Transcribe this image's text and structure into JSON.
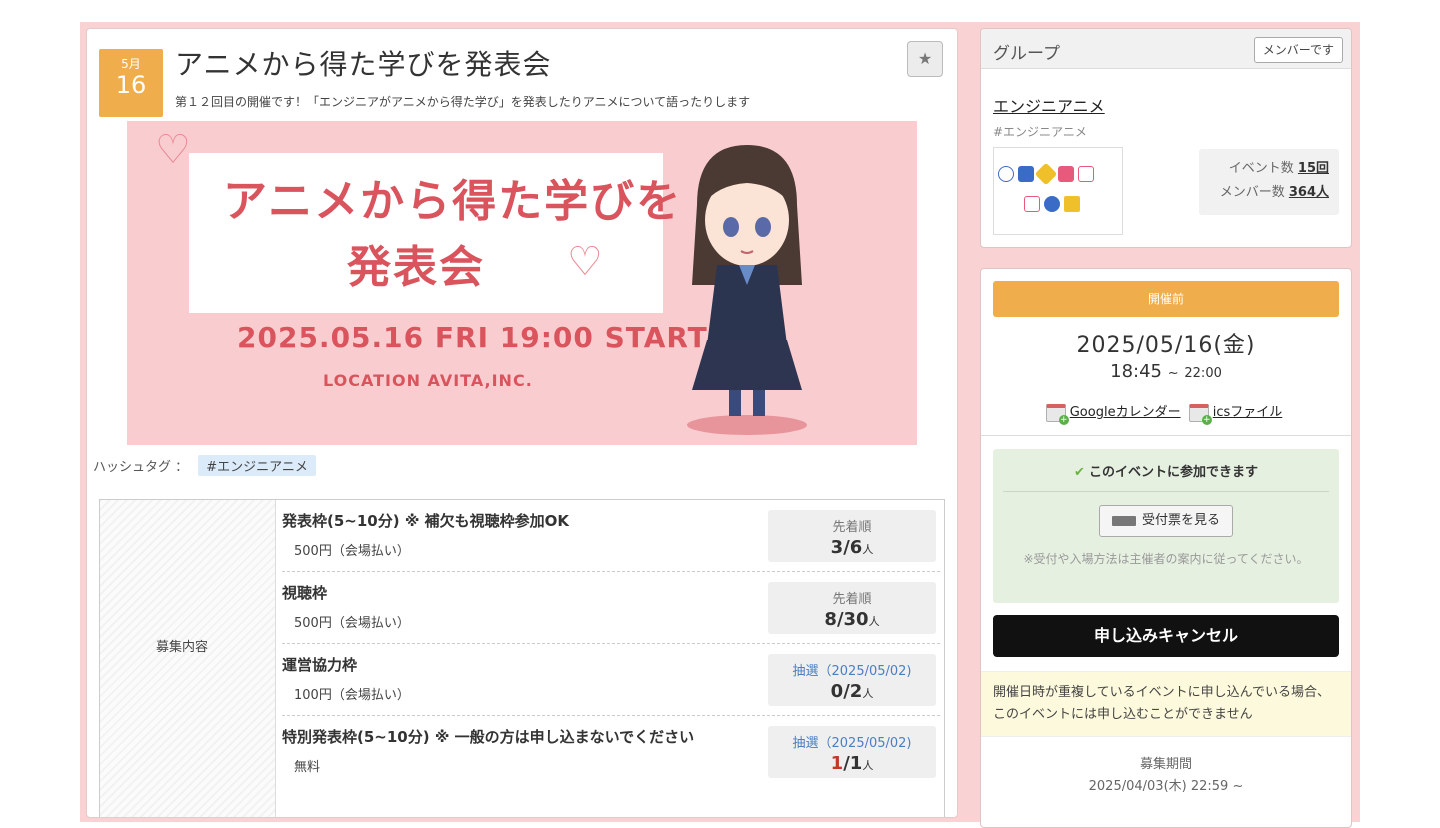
{
  "event": {
    "month": "5月",
    "day": "16",
    "title": "アニメから得た学びを発表会",
    "subtitle": "第１２回目の開催です！「エンジニアがアニメから得た学び」を発表したりアニメについて語ったりします",
    "star_icon": "★"
  },
  "banner": {
    "title_line1": "アニメから得た学びを",
    "title_line2": "発表会",
    "date_line": "2025.05.16 FRI 19:00 START",
    "location_line": "LOCATION AVITA,INC."
  },
  "hashtag": {
    "label": "ハッシュタグ ：",
    "value": "#エンジニアニメ"
  },
  "recruit": {
    "label": "募集内容",
    "slots": [
      {
        "name": "発表枠(5~10分) ※ 補欠も視聴枠参加OK",
        "price": "500円（会場払い）",
        "method": "先着順",
        "current": "3",
        "capacity": "/6",
        "unit": "人"
      },
      {
        "name": "視聴枠",
        "price": "500円（会場払い）",
        "method": "先着順",
        "current": "8",
        "capacity": "/30",
        "unit": "人"
      },
      {
        "name": "運営協力枠",
        "price": "100円（会場払い）",
        "method": "抽選（2025/05/02)",
        "current": "0",
        "capacity": "/2",
        "unit": "人"
      },
      {
        "name": "特別発表枠(5~10分) ※ 一般の方は申し込まないでください",
        "price": "無料",
        "method": "抽選（2025/05/02)",
        "current": "1",
        "capacity": "/1",
        "unit": "人"
      }
    ]
  },
  "group": {
    "heading": "グループ",
    "member_button": "メンバーです",
    "name": "エンジニアニメ",
    "tag": "#エンジニアニメ",
    "event_count_label": "イベント数",
    "event_count": "15回",
    "member_count_label": "メンバー数",
    "member_count": "364人"
  },
  "status": {
    "badge": "開催前",
    "date": "2025/05/16(金)",
    "start_time": "18:45",
    "tilde": "~",
    "end_time": "22:00",
    "google_link": "Googleカレンダー",
    "ics_link": "icsファイル",
    "join_ok": "このイベントに参加できます",
    "ticket_button": "受付票を見る",
    "join_note": "※受付や入場方法は主催者の案内に従ってください。",
    "cancel_button": "申し込みキャンセル",
    "warning": "開催日時が重複しているイベントに申し込んでいる場合、このイベントには申し込むことができません",
    "period_label": "募集期間",
    "period_value": "2025/04/03(木) 22:59 ~"
  },
  "colors": {
    "accent_orange": "#efad4c",
    "background_pink": "#f9d2d3",
    "banner_red": "#d9545d"
  }
}
